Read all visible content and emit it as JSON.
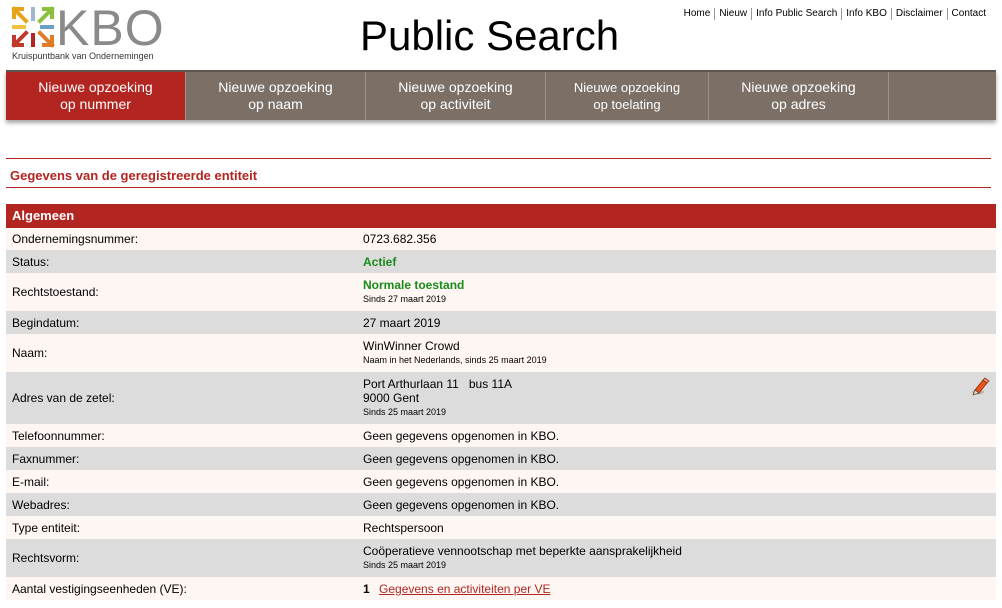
{
  "logo": {
    "letters": "KBO",
    "subtitle": "Kruispuntbank van Ondernemingen",
    "icon": "kbo-arrows-logo"
  },
  "page_title": "Public Search",
  "toplinks": [
    "Home",
    "Nieuw",
    "Info Public Search",
    "Info KBO",
    "Disclaimer",
    "Contact"
  ],
  "nav": [
    {
      "line1": "Nieuwe opzoeking",
      "line2": "op nummer",
      "active": true
    },
    {
      "line1": "Nieuwe opzoeking",
      "line2": "op naam",
      "active": false
    },
    {
      "line1": "Nieuwe opzoeking",
      "line2": "op activiteit",
      "active": false
    },
    {
      "line1": "Nieuwe opzoeking",
      "line2": "op toelating",
      "active": false
    },
    {
      "line1": "Nieuwe opzoeking",
      "line2": "op adres",
      "active": false
    }
  ],
  "section_title": "Gegevens van de geregistreerde entiteit",
  "table": {
    "header": "Algemeen",
    "ondernemingsnummer": {
      "label": "Ondernemingsnummer:",
      "value": "0723.682.356"
    },
    "status": {
      "label": "Status:",
      "value": "Actief"
    },
    "rechtstoestand": {
      "label": "Rechtstoestand:",
      "value": "Normale toestand",
      "sub": "Sinds 27 maart 2019"
    },
    "begindatum": {
      "label": "Begindatum:",
      "value": "27 maart 2019"
    },
    "naam": {
      "label": "Naam:",
      "value": "WinWinner Crowd",
      "sub": "Naam in het Nederlands, sinds 25 maart 2019"
    },
    "adres": {
      "label": "Adres van de zetel:",
      "street": "Port Arthurlaan 11",
      "bus": "bus 11A",
      "city": "9000 Gent",
      "sub": "Sinds 25 maart 2019",
      "icon": "edit-pencil-icon"
    },
    "telefoon": {
      "label": "Telefoonnummer:",
      "value": "Geen gegevens opgenomen in KBO."
    },
    "fax": {
      "label": "Faxnummer:",
      "value": "Geen gegevens opgenomen in KBO."
    },
    "email": {
      "label": "E-mail:",
      "value": "Geen gegevens opgenomen in KBO."
    },
    "web": {
      "label": "Webadres:",
      "value": "Geen gegevens opgenomen in KBO."
    },
    "type": {
      "label": "Type entiteit:",
      "value": "Rechtspersoon"
    },
    "rechtsvorm": {
      "label": "Rechtsvorm:",
      "value": "Coöperatieve vennootschap met beperkte aansprakelijkheid",
      "sub": "Sinds 25 maart 2019"
    },
    "ve": {
      "label": "Aantal vestigingseenheden (VE):",
      "count": "1",
      "link": "Gegevens en activiteiten per VE"
    }
  },
  "colors": {
    "brand_red": "#b22520",
    "nav_gray": "#7b6f66",
    "status_green": "#1a8a1a"
  }
}
